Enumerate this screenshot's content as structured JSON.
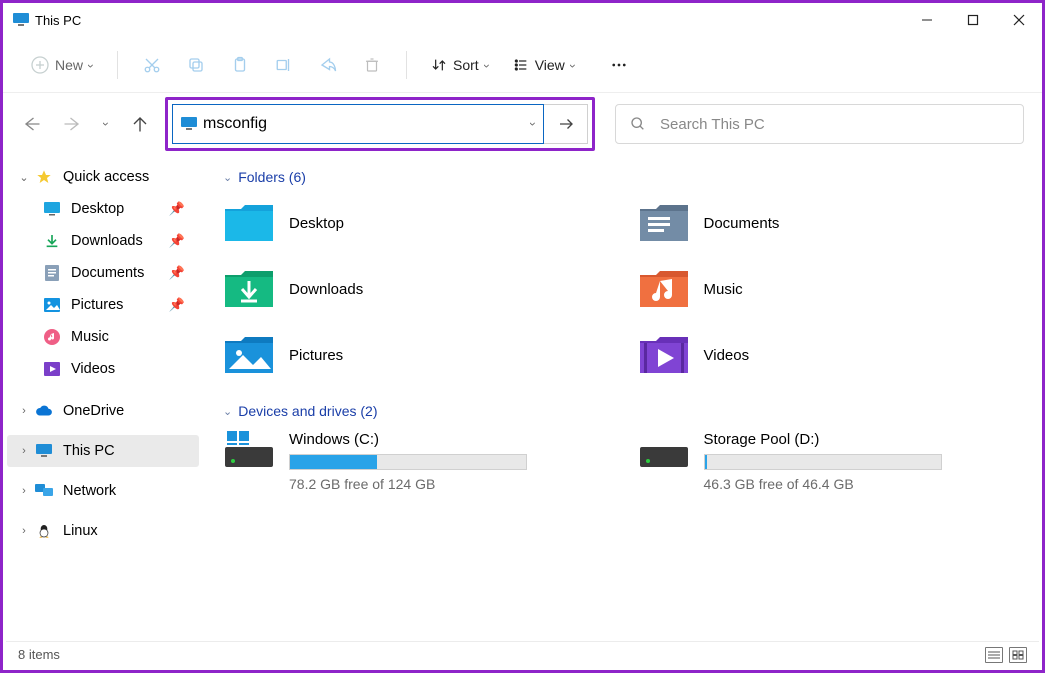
{
  "window": {
    "title": "This PC"
  },
  "toolbar": {
    "new_label": "New",
    "sort_label": "Sort",
    "view_label": "View"
  },
  "nav": {
    "address_value": "msconfig",
    "search_placeholder": "Search This PC"
  },
  "sidebar": {
    "quick_access": "Quick access",
    "items": [
      {
        "label": "Desktop",
        "pinned": true
      },
      {
        "label": "Downloads",
        "pinned": true
      },
      {
        "label": "Documents",
        "pinned": true
      },
      {
        "label": "Pictures",
        "pinned": true
      },
      {
        "label": "Music",
        "pinned": false
      },
      {
        "label": "Videos",
        "pinned": false
      }
    ],
    "onedrive": "OneDrive",
    "thispc": "This PC",
    "network": "Network",
    "linux": "Linux"
  },
  "sections": {
    "folders_head": "Folders (6)",
    "drives_head": "Devices and drives (2)"
  },
  "folders": [
    {
      "label": "Desktop"
    },
    {
      "label": "Documents"
    },
    {
      "label": "Downloads"
    },
    {
      "label": "Music"
    },
    {
      "label": "Pictures"
    },
    {
      "label": "Videos"
    }
  ],
  "drives": [
    {
      "label": "Windows (C:)",
      "free": "78.2 GB free of 124 GB",
      "fill_pct": 37
    },
    {
      "label": "Storage Pool (D:)",
      "free": "46.3 GB free of 46.4 GB",
      "fill_pct": 1
    }
  ],
  "status": {
    "text": "8 items"
  }
}
